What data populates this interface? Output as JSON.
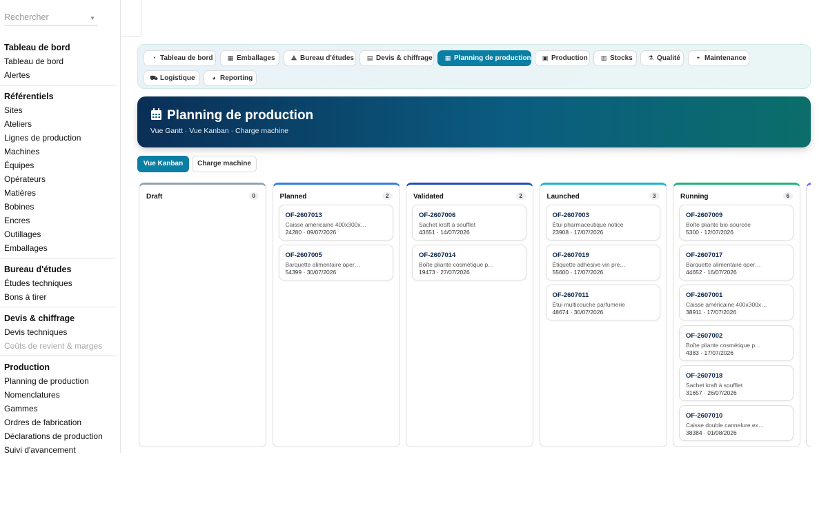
{
  "search": {
    "placeholder": "Rechercher"
  },
  "sidebar": {
    "sections": [
      {
        "title": "Tableau de bord",
        "items": [
          "Tableau de bord",
          "Alertes"
        ]
      },
      {
        "title": "Référentiels",
        "items": [
          "Sites",
          "Ateliers",
          "Lignes de production",
          "Machines",
          "Équipes",
          "Opérateurs",
          "Matières",
          "Bobines",
          "Encres",
          "Outillages",
          "Emballages"
        ]
      },
      {
        "title": "Bureau d'études",
        "items": [
          "Études techniques",
          "Bons à tirer"
        ]
      },
      {
        "title": "Devis & chiffrage",
        "items": [
          "Devis techniques",
          "Coûts de revient & marges"
        ]
      },
      {
        "title": "Production",
        "items": [
          "Planning de production",
          "Nomenclatures",
          "Gammes",
          "Ordres de fabrication",
          "Déclarations de production",
          "Suivi d'avancement"
        ]
      }
    ]
  },
  "tabs": [
    {
      "label": "Tableau de bord",
      "icon": "gauge-icon"
    },
    {
      "label": "Emballages",
      "icon": "boxes-icon"
    },
    {
      "label": "Bureau d'études",
      "icon": "compass-icon"
    },
    {
      "label": "Devis & chiffrage",
      "icon": "calculator-icon"
    },
    {
      "label": "Planning de production",
      "icon": "calendar-icon"
    },
    {
      "label": "Production",
      "icon": "clipboard-icon"
    },
    {
      "label": "Stocks",
      "icon": "warehouse-icon"
    },
    {
      "label": "Qualité",
      "icon": "flask-icon"
    },
    {
      "label": "Maintenance",
      "icon": "helmet-icon"
    },
    {
      "label": "Logistique",
      "icon": "truck-icon"
    },
    {
      "label": "Reporting",
      "icon": "chart-pie-icon"
    }
  ],
  "hero": {
    "title": "Planning de production",
    "subtitle": "Vue Gantt · Vue Kanban · Charge machine"
  },
  "views": {
    "kanban": "Vue Kanban",
    "charge": "Charge machine"
  },
  "columns": [
    {
      "name": "Draft",
      "count": "0",
      "color": "#8fa3b5",
      "cards": []
    },
    {
      "name": "Planned",
      "count": "2",
      "color": "#2f7fe0",
      "cards": [
        {
          "id": "OF-2607013",
          "desc": "Caisse américaine 400x300x…",
          "meta": "24280 · 09/07/2026"
        },
        {
          "id": "OF-2607005",
          "desc": "Barquette alimentaire oper…",
          "meta": "54399 · 30/07/2026"
        }
      ]
    },
    {
      "name": "Validated",
      "count": "2",
      "color": "#1d4fb8",
      "cards": [
        {
          "id": "OF-2607006",
          "desc": "Sachet kraft à soufflet",
          "meta": "43651 · 14/07/2026"
        },
        {
          "id": "OF-2607014",
          "desc": "Boîte pliante cosmétique p…",
          "meta": "19473 · 27/07/2026"
        }
      ]
    },
    {
      "name": "Launched",
      "count": "3",
      "color": "#18b2d6",
      "cards": [
        {
          "id": "OF-2607003",
          "desc": "Étui pharmaceutique notice",
          "meta": "23908 · 17/07/2026"
        },
        {
          "id": "OF-2607019",
          "desc": "Étiquette adhésive vin pre…",
          "meta": "55600 · 17/07/2026"
        },
        {
          "id": "OF-2607011",
          "desc": "Étui multicouche parfumerie",
          "meta": "48674 · 30/07/2026"
        }
      ]
    },
    {
      "name": "Running",
      "count": "6",
      "color": "#1fb37a",
      "cards": [
        {
          "id": "OF-2607009",
          "desc": "Boîte pliante bio-sourcée",
          "meta": "5300 · 12/07/2026"
        },
        {
          "id": "OF-2607017",
          "desc": "Barquette alimentaire oper…",
          "meta": "44652 · 16/07/2026"
        },
        {
          "id": "OF-2607001",
          "desc": "Caisse américaine 400x300x…",
          "meta": "38911 · 17/07/2026"
        },
        {
          "id": "OF-2607002",
          "desc": "Boîte pliante cosmétique p…",
          "meta": "4383 · 17/07/2026"
        },
        {
          "id": "OF-2607018",
          "desc": "Sachet kraft à soufflet",
          "meta": "31657 · 26/07/2026"
        },
        {
          "id": "OF-2607010",
          "desc": "Caisse double cannelure ex…",
          "meta": "38384 · 01/08/2026"
        }
      ]
    }
  ],
  "colors": {
    "accent": "#0b7ea3",
    "nextColumnAccent": "#8b5cf6"
  }
}
